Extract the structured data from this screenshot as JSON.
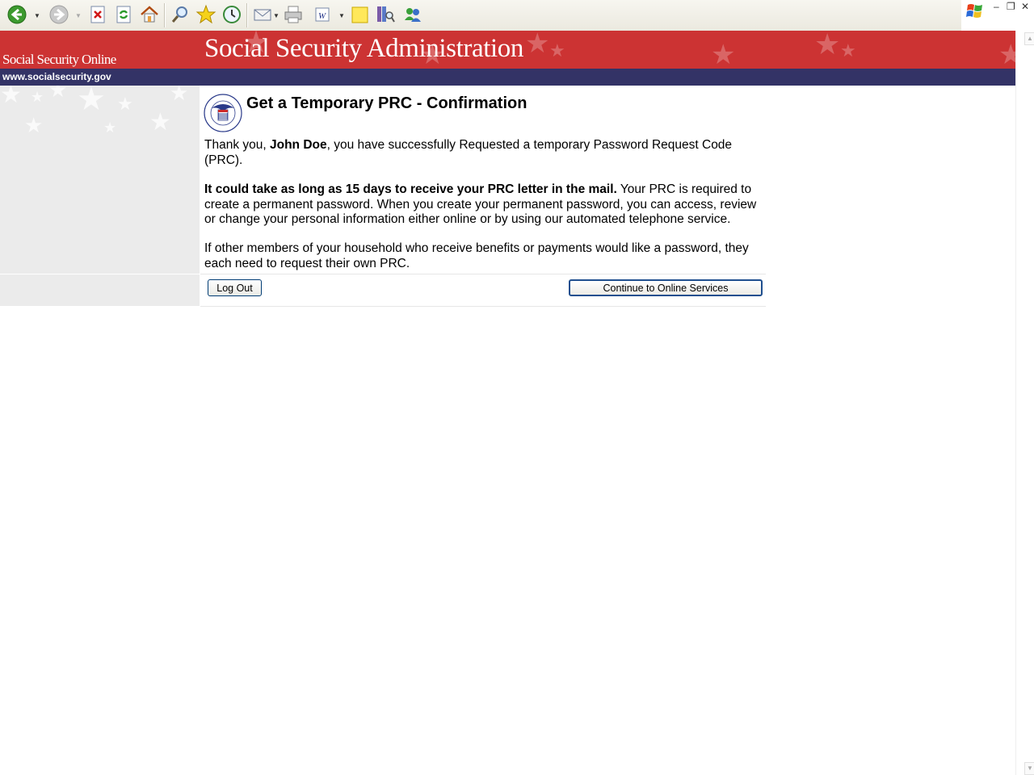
{
  "toolbar": {
    "icons": [
      "back-icon",
      "forward-icon",
      "stop-icon",
      "refresh-icon",
      "home-icon",
      "search-icon",
      "favorites-icon",
      "history-icon",
      "mail-icon",
      "print-icon",
      "edit-icon",
      "notes-icon",
      "research-icon",
      "messenger-icon"
    ]
  },
  "window": {
    "minimize": "–",
    "restore": "❐",
    "close": "✕"
  },
  "header": {
    "site_name": "Social Security Online",
    "agency_title": "Social Security Administration",
    "url": "www.socialsecurity.gov",
    "colors": {
      "banner": "#cc3333",
      "urlbar": "#333366"
    }
  },
  "content": {
    "title": "Get a Temporary PRC - Confirmation",
    "p1": {
      "prefix": "Thank you, ",
      "name": "John Doe",
      "suffix": ", you have successfully Requested a temporary Password Request Code (PRC)."
    },
    "p2": {
      "bold": "It could take as long as 15 days to receive your PRC letter in the mail.",
      "rest": " Your PRC is required to create a permanent password. When you create your permanent password, you can access, review or change your personal information either online or by using our automated telephone service."
    },
    "p3": "If other members of your household who receive benefits or payments would like a password, they each need to request their own PRC."
  },
  "buttons": {
    "logout": "Log Out",
    "continue": "Continue to Online Services"
  }
}
